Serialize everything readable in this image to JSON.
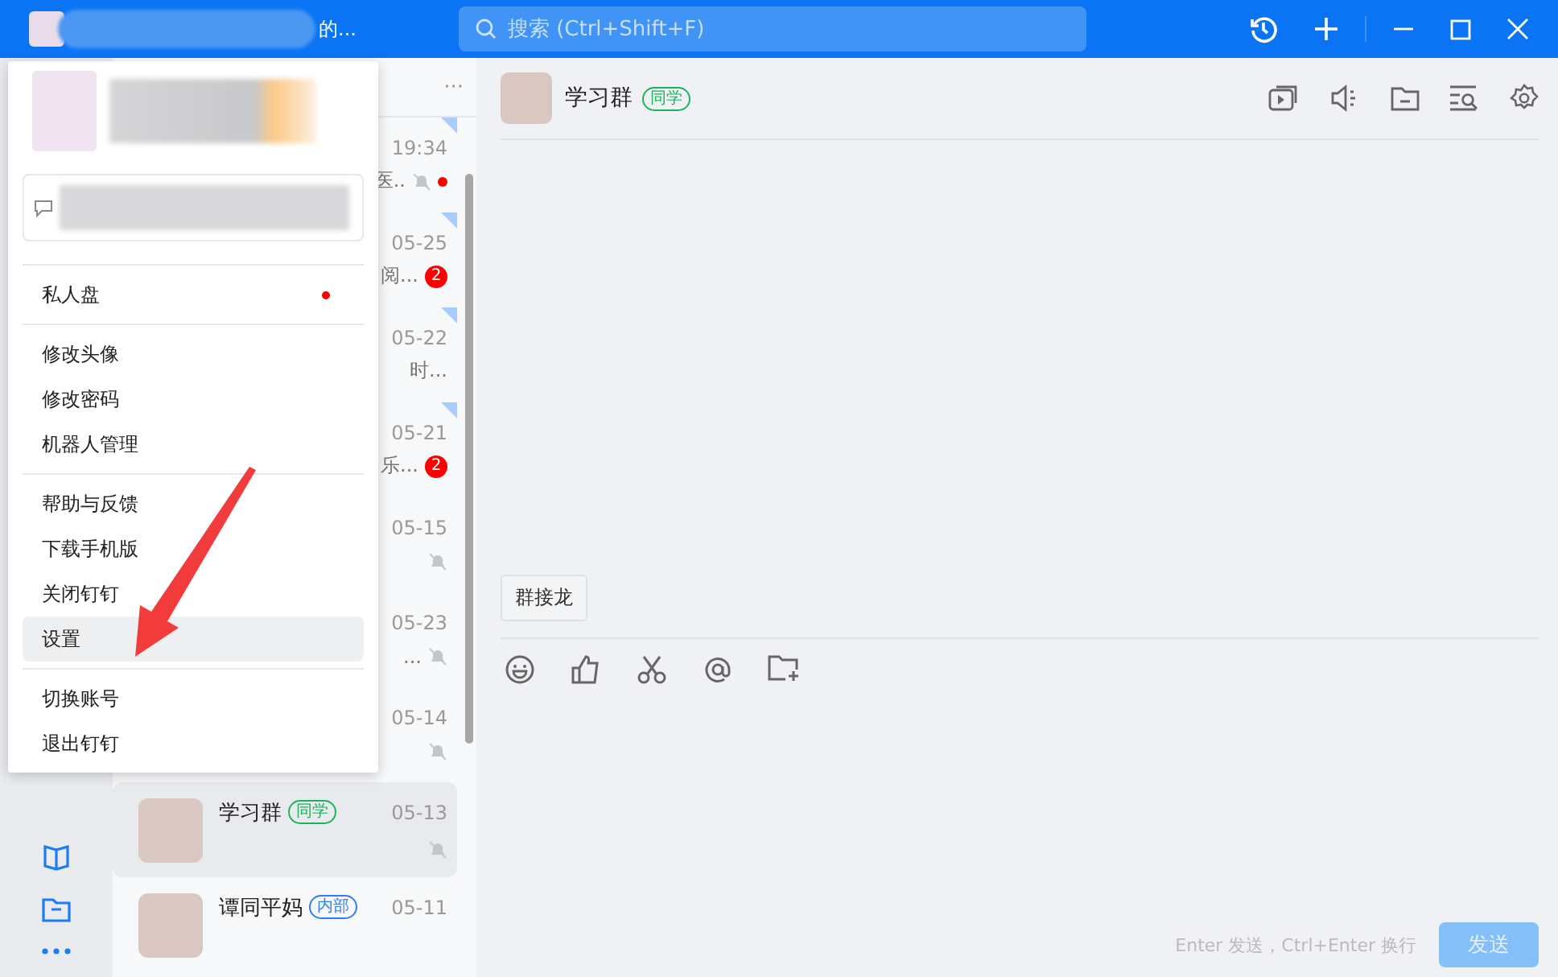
{
  "title_bar": {
    "name_tail": "的...",
    "search": {
      "placeholder": "搜索 (Ctrl+Shift+F)"
    }
  },
  "chat_list": {
    "more": "···",
    "items": [
      {
        "time": "19:34",
        "snippet": "医..",
        "pinned": true,
        "muted": true,
        "dot": true,
        "selected": false
      },
      {
        "time": "05-25",
        "snippet": "阅...",
        "pinned": true,
        "muted": false,
        "dot": false,
        "badge": "2",
        "selected": false
      },
      {
        "time": "05-22",
        "snippet": "时...",
        "pinned": true,
        "muted": false,
        "dot": false,
        "selected": false
      },
      {
        "time": "05-21",
        "snippet": "乐...",
        "pinned": true,
        "muted": false,
        "dot": false,
        "badge": "2",
        "selected": false
      },
      {
        "time": "05-15",
        "pinned": false,
        "muted": true,
        "dot": false,
        "selected": false
      },
      {
        "time": "05-23",
        "snippet": "...",
        "pinned": false,
        "muted": true,
        "dot": false,
        "selected": false
      },
      {
        "time": "05-14",
        "pinned": false,
        "muted": true,
        "dot": false,
        "selected": false
      },
      {
        "name": "学习群",
        "tag": {
          "text": "同学",
          "color": "#1ab35a"
        },
        "time": "05-13",
        "pinned": false,
        "muted": true,
        "dot": false,
        "selected": true
      },
      {
        "name": "谭同平妈",
        "tag": {
          "text": "内部",
          "color": "#2f7ef5"
        },
        "time": "05-11",
        "pinned": false,
        "muted": false,
        "dot": false,
        "selected": false
      }
    ]
  },
  "menu": {
    "sections": [
      [
        {
          "label": "私人盘",
          "dot": true,
          "selected": false
        }
      ],
      [
        {
          "label": "修改头像",
          "dot": false,
          "selected": false
        },
        {
          "label": "修改密码",
          "dot": false,
          "selected": false
        },
        {
          "label": "机器人管理",
          "dot": false,
          "selected": false
        }
      ],
      [
        {
          "label": "帮助与反馈",
          "dot": false,
          "selected": false
        },
        {
          "label": "下载手机版",
          "dot": false,
          "selected": false
        },
        {
          "label": "关闭钉钉",
          "dot": false,
          "selected": false
        },
        {
          "label": "设置",
          "dot": false,
          "selected": true
        }
      ],
      [
        {
          "label": "切换账号",
          "dot": false,
          "selected": false
        },
        {
          "label": "退出钉钉",
          "dot": false,
          "selected": false
        }
      ]
    ]
  },
  "chat": {
    "name": "学习群",
    "tag": "同学",
    "quick_action": "群接龙",
    "hint": "Enter 发送，Ctrl+Enter 换行",
    "send": "发送",
    "send_disabled": true
  }
}
